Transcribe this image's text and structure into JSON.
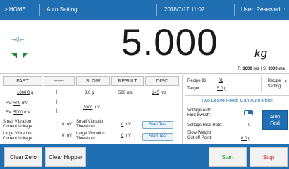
{
  "topbar": {
    "home": "> HOME",
    "title": "Auto Setting",
    "datetime": "2018/7/17 11:02",
    "user": "User: Reserved",
    "user_arrow": "›"
  },
  "weight": {
    "zero_indicator": "→0←",
    "value": "5.000",
    "unit": "kg",
    "f_label": "F:",
    "f_value": "1000 ms",
    "s_label": "S:",
    "s_value": "3000 ms"
  },
  "table": {
    "headers": [
      "FAST",
      "------",
      "SLOW",
      "RESULT",
      "DISC"
    ],
    "fast_target": "1000.0",
    "fast_unit": "g",
    "dash1": "|",
    "slow_value": "3.0",
    "slow_unit": "g",
    "result_value": "580",
    "result_unit": "ms",
    "disc_value": "245",
    "disc_unit": "ms",
    "sv1_label": "SV:",
    "sv1_value": "509",
    "sv1_unit": "mV",
    "sv2_label": "SV:",
    "sv2_value": "5000",
    "sv2_unit": "mV",
    "slow_mv": "3000",
    "slow_mv_unit": "mV",
    "small_vib_label": "Small Vibration\nCurrent Voltage:",
    "small_vib_value": "0 mV",
    "small_vib_thresh_label": "Small Vibration\nThreshold:",
    "small_vib_thresh_value": "0",
    "small_vib_thresh_unit": "mV",
    "large_vib_label": "Large Vibration\nCurrent Voltage:",
    "large_vib_value": "0 mV",
    "large_vib_thresh_label": "Large Vibration\nThreshold:",
    "large_vib_thresh_value": "0",
    "large_vib_thresh_unit": "mV",
    "start_test": "Start Test"
  },
  "right_panel": {
    "recipe_id_label": "Recipe ID:",
    "recipe_id": "01",
    "target_label": "Target:",
    "target_value": "5.0",
    "target_unit": "g",
    "recipe_setting_line1": "Recipe",
    "recipe_setting_line2": "Setting",
    "recipe_arrow": "›",
    "notice": "Two Leave Feed, Can Auto Find!",
    "vafs_label_1": "Voltage Auto",
    "vafs_label_2": "Find Switch:",
    "auto_find_1": "Auto",
    "auto_find_2": "Find",
    "vrr_label": "Voltage Rise Rate:",
    "vrr_value": "0",
    "swcp_label_1": "Slow Weight",
    "swcp_label_2": "Cut-off Point:",
    "swcp_value": "0.0",
    "swcp_unit": "g"
  },
  "bottombar": {
    "clear_zero": "Clear Zero",
    "clear_hopper": "Clear Hopper",
    "start": "Start",
    "stop": "Stop"
  },
  "colors": {
    "primary": "#1f6fb2",
    "start": "#2e9a3a",
    "stop": "#d0202a",
    "stable_indicator": "#1e8a3a"
  }
}
